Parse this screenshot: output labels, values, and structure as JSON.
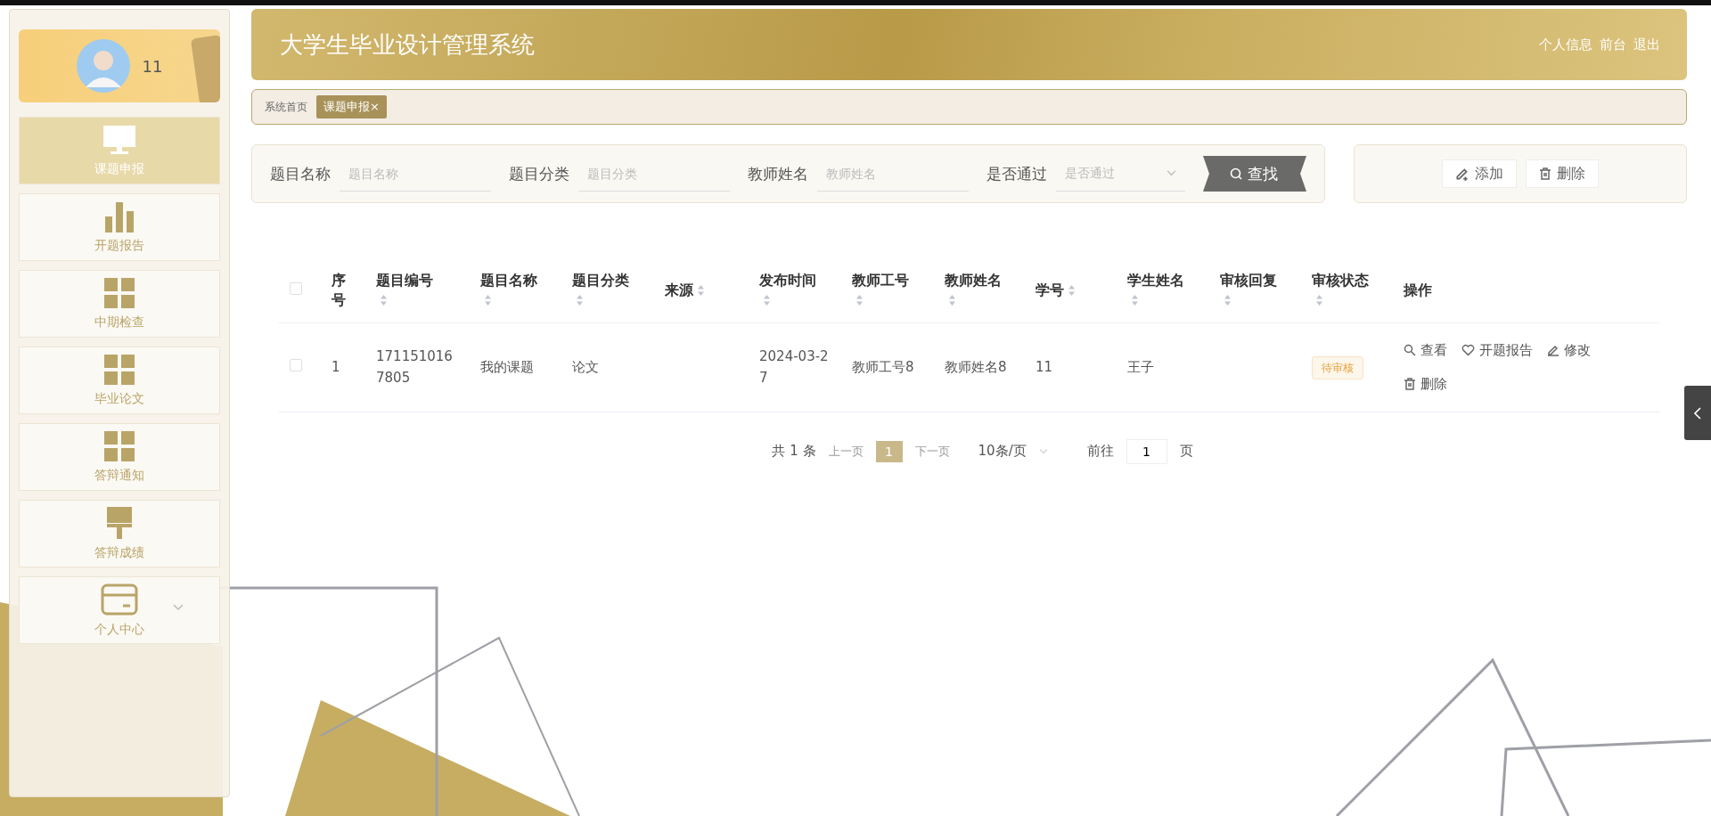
{
  "sidebar": {
    "profile": {
      "name": "11"
    },
    "items": [
      {
        "label": "课题申报",
        "kind": "monitor",
        "selected": true
      },
      {
        "label": "开题报告",
        "kind": "chart",
        "selected": false
      },
      {
        "label": "中期检查",
        "kind": "grid",
        "selected": false
      },
      {
        "label": "毕业论文",
        "kind": "grid",
        "selected": false
      },
      {
        "label": "答辩通知",
        "kind": "grid",
        "selected": false
      },
      {
        "label": "答辩成绩",
        "kind": "brush",
        "selected": false
      },
      {
        "label": "个人中心",
        "kind": "card",
        "selected": false,
        "expanded": false
      }
    ]
  },
  "header": {
    "title": "大学生毕业设计管理系统",
    "links": [
      "个人信息",
      "前台",
      "退出"
    ]
  },
  "breadcrumb": {
    "home": "系统首页",
    "tabs": [
      {
        "label": "课题申报",
        "close": "×",
        "selected": true
      }
    ]
  },
  "search": {
    "fields": [
      {
        "kind": "input",
        "label": "题目名称",
        "placeholder": "题目名称"
      },
      {
        "kind": "input",
        "label": "题目分类",
        "placeholder": "题目分类"
      },
      {
        "kind": "input",
        "label": "教师姓名",
        "placeholder": "教师姓名"
      },
      {
        "kind": "select",
        "label": "是否通过",
        "placeholder": "是否通过"
      }
    ],
    "button": "查找"
  },
  "actions": [
    {
      "kind": "add",
      "label": "添加"
    },
    {
      "kind": "delete",
      "label": "删除"
    }
  ],
  "table": {
    "all_checked": false,
    "columns": [
      {
        "label": "序号",
        "sortable": false
      },
      {
        "label": "题目编号",
        "sortable": true
      },
      {
        "label": "题目名称",
        "sortable": true
      },
      {
        "label": "题目分类",
        "sortable": true
      },
      {
        "label": "来源",
        "sortable": true
      },
      {
        "label": "发布时间",
        "sortable": true
      },
      {
        "label": "教师工号",
        "sortable": true
      },
      {
        "label": "教师姓名",
        "sortable": true
      },
      {
        "label": "学号",
        "sortable": true
      },
      {
        "label": "学生姓名",
        "sortable": true
      },
      {
        "label": "审核回复",
        "sortable": true
      },
      {
        "label": "审核状态",
        "sortable": true
      },
      {
        "label": "操作",
        "sortable": false
      }
    ],
    "rows": [
      {
        "checked": false,
        "cells": [
          "1",
          "1711510167805",
          "我的课题",
          "论文",
          "",
          "2024-03-27",
          "教师工号8",
          "教师姓名8",
          "11",
          "王子",
          ""
        ],
        "status": {
          "label": "待审核",
          "color": "#e6a23c"
        },
        "operations": [
          {
            "kind": "view",
            "label": "查看"
          },
          {
            "kind": "report",
            "label": "开题报告"
          },
          {
            "kind": "edit",
            "label": "修改"
          },
          {
            "kind": "delete",
            "label": "删除"
          }
        ]
      }
    ]
  },
  "pagination": {
    "total": "共 1 条",
    "prev": "上一页",
    "pages": [
      {
        "label": "1",
        "selected": true
      }
    ],
    "next": "下一页",
    "page_size": "10条/页",
    "goto_label": "前往",
    "goto_value": "1",
    "goto_suffix": "页"
  }
}
